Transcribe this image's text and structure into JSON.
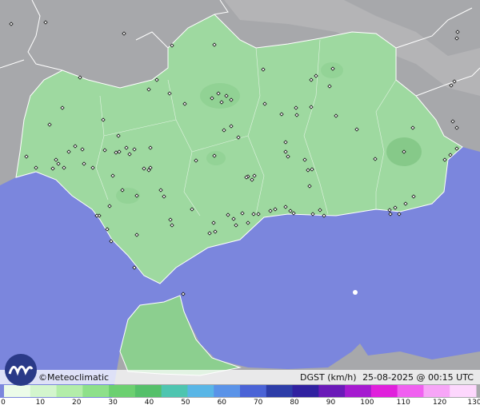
{
  "map": {
    "credit": "Meteoclimatic",
    "credit_symbol": "©",
    "variable": "DGST (km/h)",
    "timestamp": "25-08-2025 @ 00:15 UTC",
    "logo_icon": "meteoclimatic-logo-icon",
    "colors": {
      "sea": "#7b86dd",
      "terrain": "#a9a9ab",
      "land_region": "#9ed9a0",
      "land_strong": "#7fc483",
      "borders": "#ffffff",
      "station": "#111111"
    }
  },
  "scale": {
    "labels": [
      "0",
      "10",
      "20",
      "30",
      "40",
      "50",
      "60",
      "70",
      "80",
      "90",
      "100",
      "110",
      "120",
      "130"
    ],
    "min": 0,
    "max": 130,
    "colors": [
      "#ecfbe9",
      "#d3f5cd",
      "#b3eda9",
      "#8ee08a",
      "#6cd070",
      "#55c06a",
      "#4ec5b0",
      "#59b6e6",
      "#5a93e8",
      "#4a63d6",
      "#2d3da8",
      "#3021a0",
      "#6a1ab8",
      "#a51ad0",
      "#e020dc",
      "#f060f0",
      "#f7a5f7",
      "#fdd7fd"
    ]
  }
}
